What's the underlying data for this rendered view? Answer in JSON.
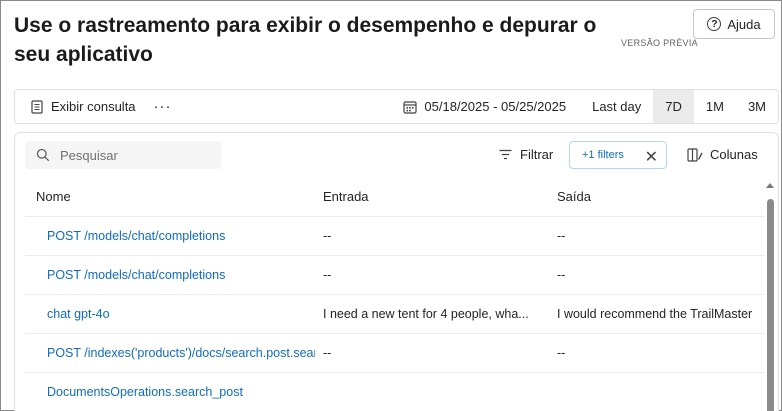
{
  "page": {
    "title": "Use o rastreamento para exibir o desempenho e depurar o seu aplicativo",
    "badge": "VERSÃO PRÉVIA",
    "help_label": "Ajuda"
  },
  "toolbar": {
    "view_query_label": "Exibir consulta",
    "more_label": "···",
    "date_range": "05/18/2025 - 05/25/2025",
    "ranges": [
      {
        "label": "Last day",
        "active": false
      },
      {
        "label": "7D",
        "active": true
      },
      {
        "label": "1M",
        "active": false
      },
      {
        "label": "3M",
        "active": false
      }
    ]
  },
  "controls": {
    "search_placeholder": "Pesquisar",
    "filter_label": "Filtrar",
    "filter_chip_label": "+1 filters",
    "columns_label": "Colunas"
  },
  "table": {
    "columns": [
      "Nome",
      "Entrada",
      "Saída"
    ],
    "rows": [
      {
        "name": "POST /models/chat/completions",
        "input": "--",
        "output": "--"
      },
      {
        "name": "POST /models/chat/completions",
        "input": "--",
        "output": "--"
      },
      {
        "name": "chat gpt-4o",
        "input": "I need a new tent for 4 people, wha...",
        "output": "I would recommend the TrailMaster"
      },
      {
        "name": "POST /indexes('products')/docs/search.post.search",
        "input": "--",
        "output": "--"
      },
      {
        "name": "DocumentsOperations.search_post",
        "input": "",
        "output": ""
      }
    ]
  },
  "colors": {
    "link": "#0f6cbd",
    "active_range_bg": "#ebebeb",
    "chip_border": "#b4d6fa"
  }
}
